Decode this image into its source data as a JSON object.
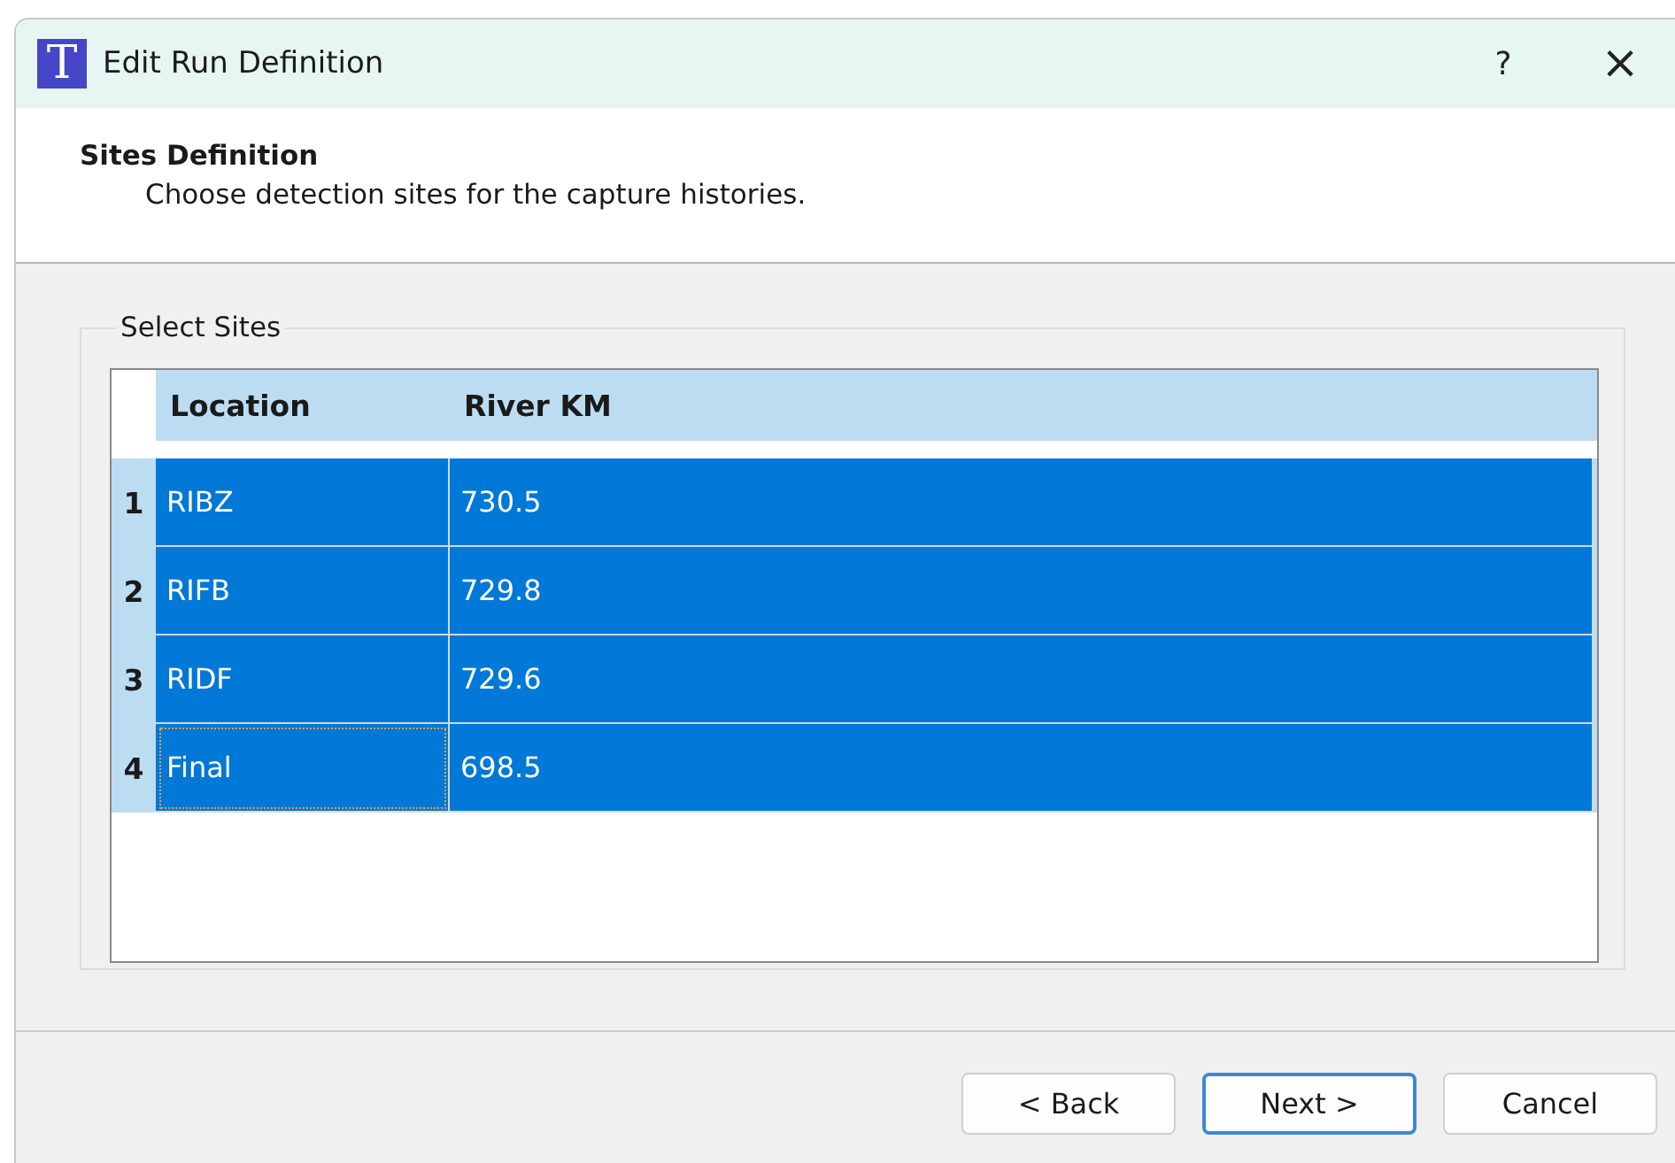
{
  "window": {
    "icon_letter": "T",
    "title": "Edit Run Definition",
    "help": "?",
    "close": "×"
  },
  "header": {
    "title": "Sites Definition",
    "subtitle": "Choose detection sites for the capture histories."
  },
  "group": {
    "title": "Select Sites"
  },
  "table": {
    "columns": [
      "Location",
      "River KM"
    ],
    "rows": [
      {
        "number": "1",
        "location": "RIBZ",
        "river_km": "730.5",
        "selected": true,
        "focused": false
      },
      {
        "number": "2",
        "location": "RIFB",
        "river_km": "729.8",
        "selected": true,
        "focused": false
      },
      {
        "number": "3",
        "location": "RIDF",
        "river_km": "729.6",
        "selected": true,
        "focused": false
      },
      {
        "number": "4",
        "location": "Final",
        "river_km": "698.5",
        "selected": true,
        "focused": true
      }
    ]
  },
  "buttons": [
    {
      "label": "< Back",
      "default": false
    },
    {
      "label": "Next >",
      "default": true
    },
    {
      "label": "Cancel",
      "default": false
    }
  ]
}
